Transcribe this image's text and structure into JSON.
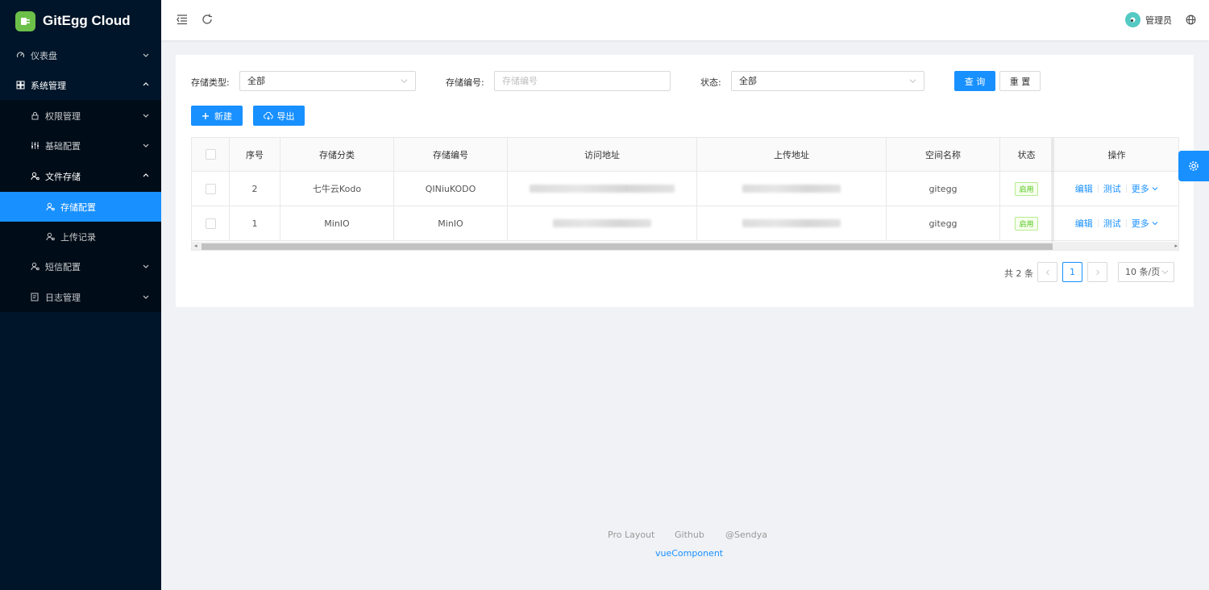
{
  "app": {
    "title": "GitEgg Cloud",
    "logo_color": "#6cc04a"
  },
  "sidebar": {
    "items": [
      {
        "label": "仪表盘"
      },
      {
        "label": "系统管理"
      },
      {
        "label": "权限管理"
      },
      {
        "label": "基础配置"
      },
      {
        "label": "文件存储"
      },
      {
        "label": "存储配置"
      },
      {
        "label": "上传记录"
      },
      {
        "label": "短信配置"
      },
      {
        "label": "日志管理"
      }
    ]
  },
  "header": {
    "user_name": "管理员"
  },
  "filters": {
    "storage_type_label": "存储类型:",
    "storage_type_value": "全部",
    "storage_code_label": "存储编号:",
    "storage_code_placeholder": "存储编号",
    "status_label": "状态:",
    "status_value": "全部",
    "query_button": "查 询",
    "reset_button": "重 置"
  },
  "toolbar": {
    "new_button": "新建",
    "export_button": "导出"
  },
  "table": {
    "columns": [
      "序号",
      "存储分类",
      "存储编号",
      "访问地址",
      "上传地址",
      "空间名称",
      "状态",
      "操作"
    ],
    "rows": [
      {
        "index": "2",
        "category": "七牛云Kodo",
        "code": "QINiuKODO",
        "space": "gitegg",
        "status": "启用",
        "actions": [
          "编辑",
          "测试",
          "更多"
        ]
      },
      {
        "index": "1",
        "category": "MinIO",
        "code": "MinIO",
        "space": "gitegg",
        "status": "启用",
        "actions": [
          "编辑",
          "测试",
          "更多"
        ]
      }
    ]
  },
  "pagination": {
    "total": "共 2 条",
    "current": "1",
    "page_size": "10 条/页"
  },
  "footer": {
    "links": [
      "Pro Layout",
      "Github",
      "@Sendya"
    ],
    "component_link": "vueComponent"
  },
  "colors": {
    "primary": "#1890ff",
    "sidebar_bg": "#001529",
    "success": "#52c41a"
  }
}
